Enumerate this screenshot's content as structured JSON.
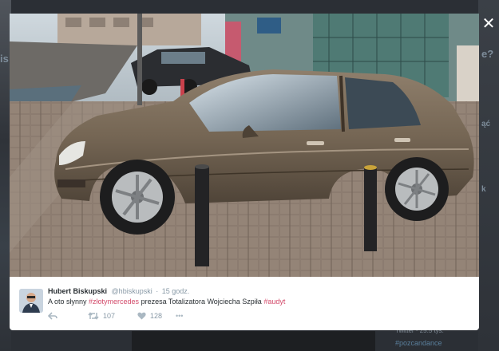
{
  "lightbox": {
    "close_symbol": "✕"
  },
  "tweet": {
    "author_name": "Hubert Biskupski",
    "author_handle": "@hbiskupski",
    "separator": "·",
    "time": "15 godz.",
    "text": {
      "part1": "A oto słynny ",
      "hashtag1": "#złotymercedes",
      "part2": " prezesa Totalizatora Wojciecha Szpiła ",
      "hashtag2": "#audyt"
    },
    "actions": {
      "retweet_count": "107",
      "like_count": "128",
      "more_symbol": "•••"
    }
  },
  "background": {
    "side_text_1": "e?",
    "side_text_2": "ąć",
    "side_text_3": "k",
    "side_left_1": "is",
    "bottom_right_1": "Twitter · 25.5 tys.",
    "bottom_right_2": "#pozcandance"
  },
  "icons": [
    "close-icon",
    "reply-icon",
    "retweet-icon",
    "heart-icon",
    "more-icon"
  ],
  "colors": {
    "hashtag": "#d34a6a",
    "muted": "#8899a6",
    "text": "#292f33",
    "car": "#7a6a58"
  }
}
